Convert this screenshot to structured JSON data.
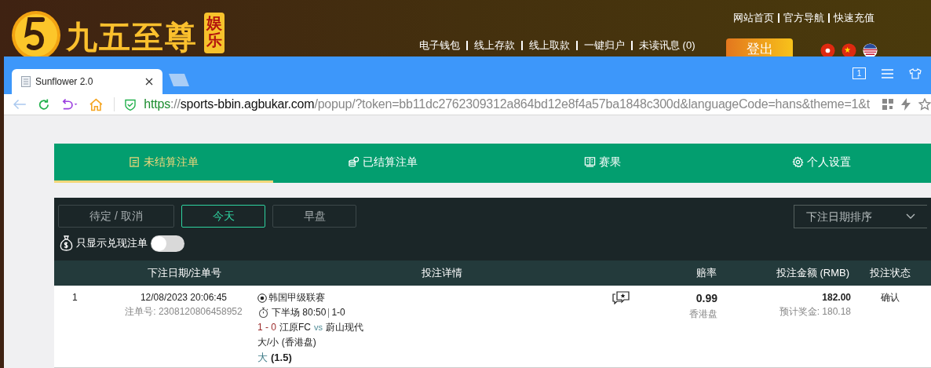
{
  "site": {
    "logo_text": "九五至尊",
    "logo_badge": "娱乐",
    "top_links": [
      "网站首页",
      "官方导航",
      "快速充值"
    ],
    "nav_links": [
      "电子钱包",
      "线上存款",
      "线上取款",
      "一键归户",
      "未读讯息 (0)"
    ],
    "logout_button": "登出"
  },
  "browser": {
    "tabs": [
      {
        "title": "Sunflower 2.0",
        "selected": true
      }
    ],
    "tab_count": "1",
    "url": {
      "scheme": "https",
      "sep": "://",
      "host": "sports-bbin.agbukar.com",
      "rest": "/popup/?token=bb11dc2762309312a864bd12e8f4a57ba1848c300d&languageCode=hans&theme=1&t"
    }
  },
  "page": {
    "tabs": [
      {
        "label": "未结算注单",
        "kind": "open",
        "selected": true
      },
      {
        "label": "已结算注单",
        "kind": "settled",
        "selected": false
      },
      {
        "label": "赛果",
        "kind": "results",
        "selected": false
      },
      {
        "label": "个人设置",
        "kind": "settings",
        "selected": false
      }
    ],
    "filters": [
      {
        "label": "待定 / 取消",
        "selected": false
      },
      {
        "label": "今天",
        "selected": true
      },
      {
        "label": "早盘",
        "selected": false
      }
    ],
    "sort": "下注日期排序",
    "cashout_toggle": {
      "label": "只显示兑现注单",
      "on": false
    },
    "table": {
      "columns": [
        "下注日期/注单号",
        "投注详情",
        "赔率",
        "投注金额 (RMB)",
        "投注状态"
      ],
      "rows": [
        {
          "index": "1",
          "date": "12/08/2023 20:06:45",
          "ticket": "注单号: 2308120806458952",
          "league": "韩国甲级联赛",
          "period": "下半场 80:50",
          "live_score": "1-0",
          "score": "1 - 0",
          "home": "江原FC",
          "vs": "vs",
          "away": "蔚山现代",
          "market": "大/小 (香港盘)",
          "pick": "大",
          "line": "(1.5)",
          "odds": "0.99",
          "odds_type": "香港盘",
          "stake": "182.00",
          "payout": "预计奖金: 180.18",
          "status": "确认"
        }
      ]
    }
  }
}
